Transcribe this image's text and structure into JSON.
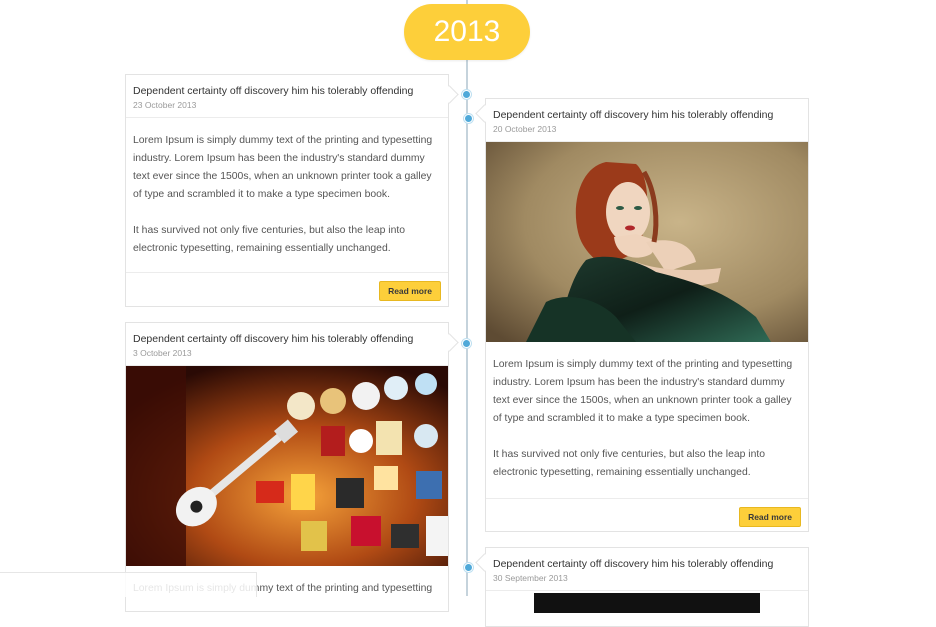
{
  "timeline": {
    "year": "2013",
    "accent_color": "#fdcf3a",
    "dot_color": "#4fa9d9"
  },
  "posts": [
    {
      "title": "Dependent certainty off discovery him his tolerably offending",
      "date": "23 October 2013",
      "paragraphs": [
        "Lorem Ipsum is simply dummy text of the printing and typesetting industry. Lorem Ipsum has been the industry's standard dummy text ever since the 1500s, when an unknown printer took a galley of type and scrambled it to make a type specimen book.",
        "It has survived not only five centuries, but also the leap into electronic typesetting, remaining essentially unchanged."
      ],
      "read_more": "Read more"
    },
    {
      "title": "Dependent certainty off discovery him his tolerably offending",
      "date": "20 October 2013",
      "image_alt": "woman in green dress photo",
      "paragraphs": [
        "Lorem Ipsum is simply dummy text of the printing and typesetting industry. Lorem Ipsum has been the industry's standard dummy text ever since the 1500s, when an unknown printer took a galley of type and scrambled it to make a type specimen book.",
        "It has survived not only five centuries, but also the leap into electronic typesetting, remaining essentially unchanged."
      ],
      "read_more": "Read more"
    },
    {
      "title": "Dependent certainty off discovery him his tolerably offending",
      "date": "3 October 2013",
      "image_alt": "bar wall with signs and guitar photo",
      "paragraphs": [
        "Lorem Ipsum is simply dummy text of the printing and typesetting"
      ]
    },
    {
      "title": "Dependent certainty off discovery him his tolerably offending",
      "date": "30 September 2013"
    }
  ]
}
